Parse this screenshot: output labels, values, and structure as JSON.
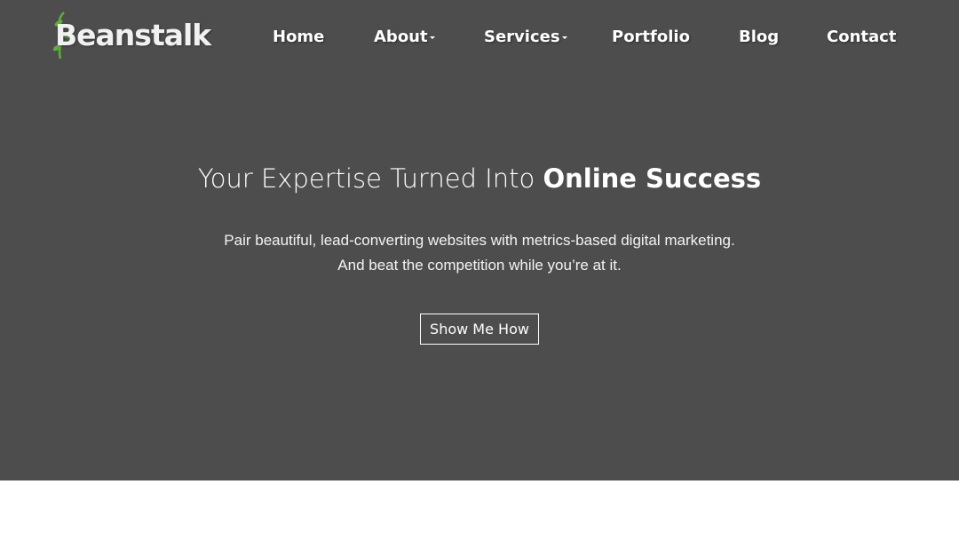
{
  "brand": {
    "logo_text": "Beanstalk",
    "leaf_color": "#5fae3a"
  },
  "nav": {
    "items": [
      {
        "label": "Home",
        "has_dropdown": false
      },
      {
        "label": "About",
        "has_dropdown": true
      },
      {
        "label": "Services",
        "has_dropdown": true
      },
      {
        "label": "Portfolio",
        "has_dropdown": false
      },
      {
        "label": "Blog",
        "has_dropdown": false
      },
      {
        "label": "Contact",
        "has_dropdown": false
      }
    ]
  },
  "hero": {
    "headline_light": "Your Expertise Turned Into ",
    "headline_bold": "Online Success",
    "subtext_line1": "Pair beautiful, lead-converting websites with metrics-based digital marketing.",
    "subtext_line2": "And beat the competition while you’re at it.",
    "cta_label": "Show Me How",
    "background_color": "#4d4d4d"
  }
}
